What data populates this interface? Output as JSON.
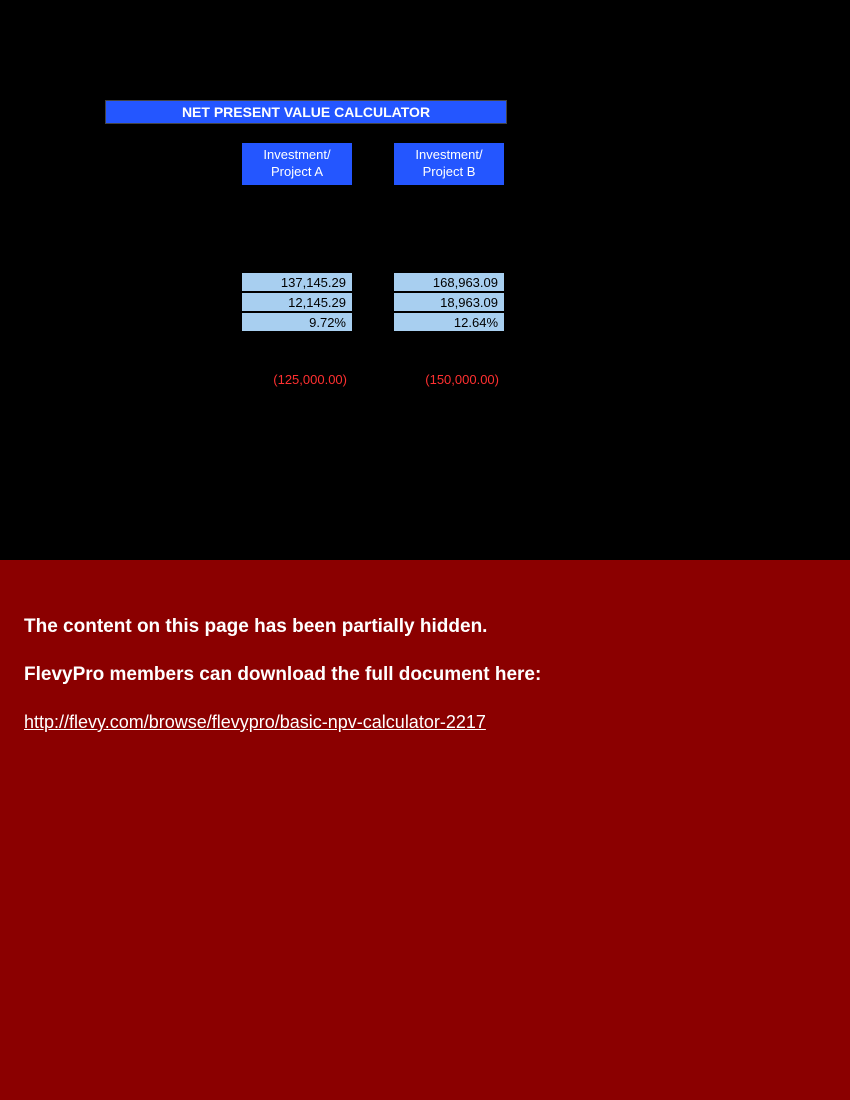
{
  "calculator": {
    "title": "NET PRESENT VALUE CALCULATOR",
    "headers": {
      "project_a": "Investment/\nProject A",
      "project_b": "Investment/\nProject B"
    },
    "results": {
      "row1_a": "137,145.29",
      "row1_b": "168,963.09",
      "row2_a": "12,145.29",
      "row2_b": "18,963.09",
      "row3_a": "9.72%",
      "row3_b": "12.64%"
    },
    "initial": {
      "a": "(125,000.00)",
      "b": "(150,000.00)"
    }
  },
  "notice": {
    "line1": "The content on this page has been partially hidden.",
    "line2": "FlevyPro members can download the full document here:",
    "link": "http://flevy.com/browse/flevypro/basic-npv-calculator-2217"
  }
}
